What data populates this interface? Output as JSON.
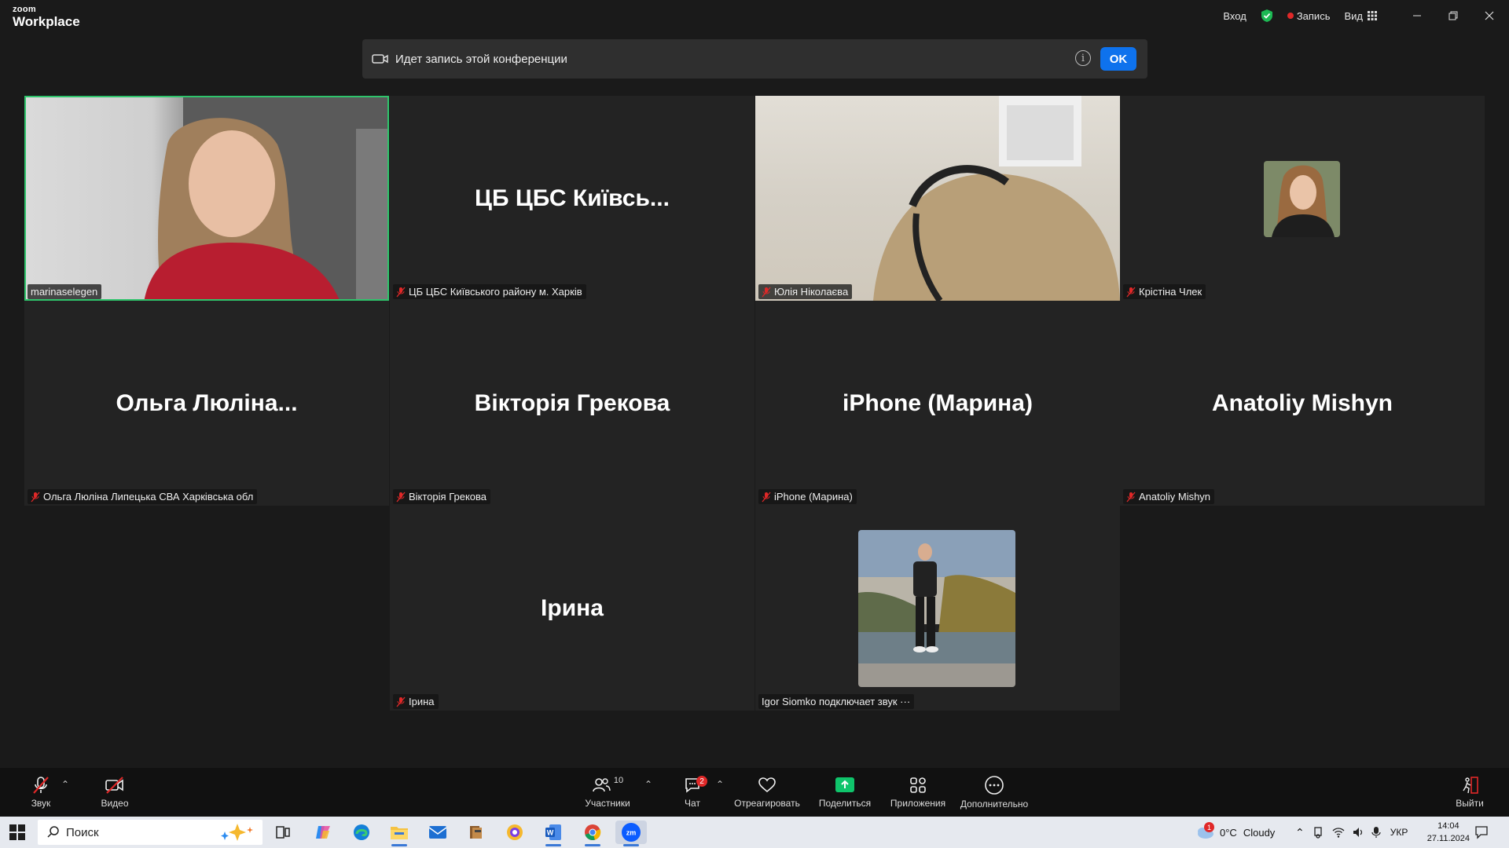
{
  "app": {
    "logo_top": "zoom",
    "logo_bottom": "Workplace"
  },
  "titlebar": {
    "login": "Вход",
    "record": "Запись",
    "view": "Вид"
  },
  "banner": {
    "text": "Идет запись этой конференции",
    "info": "i",
    "ok": "OK"
  },
  "tiles": [
    {
      "tag": "marinaselegen"
    },
    {
      "big": "ЦБ ЦБС Київсь...",
      "tag": "ЦБ ЦБС Київського району м. Харків"
    },
    {
      "tag": "Юлія Ніколаєва"
    },
    {
      "tag": "Крістіна Члек"
    },
    {
      "big": "Ольга Люліна...",
      "tag": "Ольга Люліна Липецька СВА Харківська обл"
    },
    {
      "big": "Вікторія Грекова",
      "tag": "Вікторія Грекова"
    },
    {
      "big": "iPhone (Марина)",
      "tag": "iPhone (Марина)"
    },
    {
      "big": "Anatoliy Mishyn",
      "tag": "Anatoliy Mishyn"
    },
    {
      "big": "Ірина",
      "tag": "Ірина"
    },
    {
      "tag": "Igor Siomko подключает звук ···"
    }
  ],
  "toolbar": {
    "audio": "Звук",
    "video": "Видео",
    "participants": "Участники",
    "participants_count": "10",
    "chat": "Чат",
    "chat_badge": "2",
    "react": "Отреагировать",
    "share": "Поделиться",
    "apps": "Приложения",
    "more": "Дополнительно",
    "leave": "Выйти"
  },
  "taskbar": {
    "search": "Поиск",
    "weather_temp": "0°C",
    "weather_text": "Cloudy",
    "weather_badge": "1",
    "lang": "УКР",
    "time": "14:04",
    "date": "27.11.2024"
  },
  "colors": {
    "active_speaker": "#2ec46b",
    "ok_button": "#0e72ed",
    "recording": "#e02828",
    "share": "#0fc46b"
  }
}
